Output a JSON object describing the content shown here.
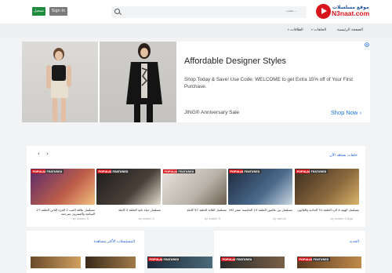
{
  "header": {
    "logo_top": "موقع مسلسلات",
    "logo_main": "N3naat.com",
    "search_placeholder": "بحث...",
    "signin_label": "Sign In",
    "register_label": "تسجيل"
  },
  "nav": {
    "items": [
      {
        "label": "الصفحة الرئيسية"
      },
      {
        "label": "الحلقات"
      },
      {
        "label": "الطاقات"
      }
    ]
  },
  "ad": {
    "title": "Affordable Designer Styles",
    "description": "Shop Today & Save! Use Code: WELCOME to get Extra 15% off of Your First Purchase.",
    "brand": "JING® Anniversary Sale",
    "cta": "Shop Now"
  },
  "section1": {
    "title": "حلقات تشاهد الآن",
    "prev": "‹",
    "next": "›",
    "badge_popular": "POPULAR",
    "badge_featured": "FEATURED",
    "cards": [
      {
        "title": "مسلسل الهيبة 4 الرد الحلقة 31 الحادية والثلاثون",
        "meta": "by admin 4 Ago",
        "colors": [
          "#3c2c1e",
          "#8c6a3e",
          "#d9b46a"
        ]
      },
      {
        "title": "مسلسل بين عالمين الحلقة 15 الخامسة عشر HD",
        "meta": "by admin",
        "colors": [
          "#1e2a3c",
          "#4a6a8c",
          "#c9d6e0"
        ]
      },
      {
        "title": "مسلسل الثلاثة الحلقة 57 كاملة",
        "meta": "by admin 5",
        "colors": [
          "#e8e4de",
          "#b9b2a8",
          "#6a5e50"
        ]
      },
      {
        "title": "مسلسل حياة ثانية الحلقة 2 كاملة",
        "meta": "by admin 2",
        "colors": [
          "#1c1c1c",
          "#4a4038",
          "#e4dcd0"
        ]
      },
      {
        "title": "مسلسل علاقة الحب 2 الجزء الثاني الحلقة 27 السابعة والعشرون مترجمة",
        "meta": "by admin 5",
        "colors": [
          "#5a2a6a",
          "#c0604a",
          "#f0c080"
        ]
      }
    ]
  },
  "section2": {
    "title_right": "الجديد",
    "title_left": "المسلسلات الأكثر مشاهدة",
    "badge_popular": "POPULAR",
    "badge_featured": "FEATURED"
  },
  "colors": {
    "accent": "#1a5ed8",
    "brand_red": "#d7151d",
    "register_green": "#1e8a3e",
    "ad_link": "#1a73e8"
  },
  "icons": [
    "logo-play-icon",
    "search-icon",
    "chevron-left-icon",
    "chevron-right-icon",
    "adchoices-icon",
    "shop-arrow-icon"
  ]
}
